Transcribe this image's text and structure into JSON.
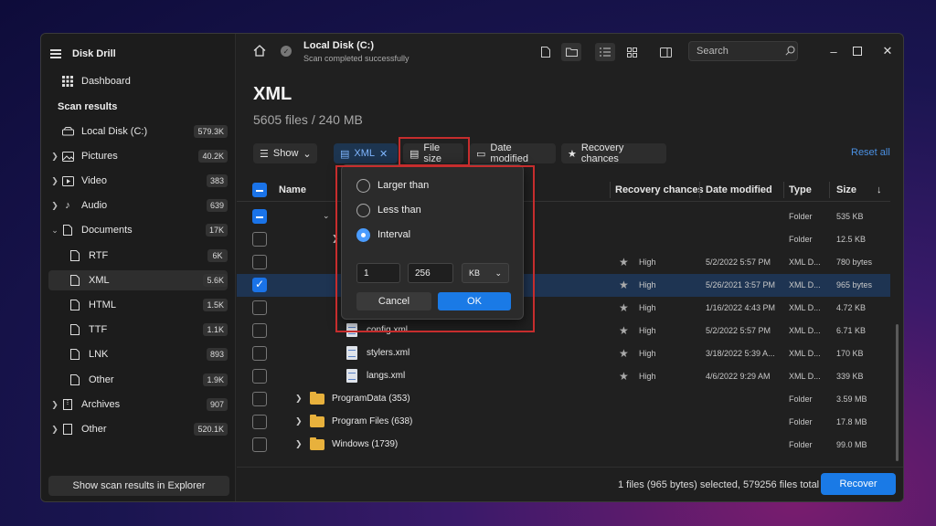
{
  "app": {
    "title": "Disk Drill"
  },
  "sidebar": {
    "dashboard": "Dashboard",
    "section": "Scan results",
    "items": [
      {
        "label": "Local Disk (C:)",
        "count": "579.3K"
      },
      {
        "label": "Pictures",
        "count": "40.2K"
      },
      {
        "label": "Video",
        "count": "383"
      },
      {
        "label": "Audio",
        "count": "639"
      },
      {
        "label": "Documents",
        "count": "17K"
      },
      {
        "label": "RTF",
        "count": "6K"
      },
      {
        "label": "XML",
        "count": "5.6K"
      },
      {
        "label": "HTML",
        "count": "1.5K"
      },
      {
        "label": "TTF",
        "count": "1.1K"
      },
      {
        "label": "LNK",
        "count": "893"
      },
      {
        "label": "Other",
        "count": "1.9K"
      },
      {
        "label": "Archives",
        "count": "907"
      },
      {
        "label": "Other",
        "count": "520.1K"
      }
    ],
    "explorer_button": "Show scan results in Explorer"
  },
  "topbar": {
    "disk_title": "Local Disk (C:)",
    "disk_status": "Scan completed successfully",
    "search_placeholder": "Search"
  },
  "page": {
    "title": "XML",
    "summary": "5605 files / 240 MB"
  },
  "filters": {
    "show": "Show",
    "xml": "XML",
    "file_size": "File size",
    "date_modified": "Date modified",
    "recovery_chances": "Recovery chances",
    "reset": "Reset all"
  },
  "table": {
    "headers": {
      "name": "Name",
      "recovery": "Recovery chances",
      "date": "Date modified",
      "type": "Type",
      "size": "Size"
    },
    "rows": [
      {
        "name": "",
        "recovery": "",
        "date": "",
        "type": "Folder",
        "size": "535 KB"
      },
      {
        "name": "",
        "recovery": "",
        "date": "",
        "type": "Folder",
        "size": "12.5 KB"
      },
      {
        "name": "",
        "recovery": "High",
        "date": "5/2/2022 5:57 PM",
        "type": "XML D...",
        "size": "780 bytes"
      },
      {
        "name": "",
        "recovery": "High",
        "date": "5/26/2021 3:57 PM",
        "type": "XML D...",
        "size": "965 bytes"
      },
      {
        "name": "",
        "recovery": "High",
        "date": "1/16/2022 4:43 PM",
        "type": "XML D...",
        "size": "4.72 KB"
      },
      {
        "name": "config.xml",
        "recovery": "High",
        "date": "5/2/2022 5:57 PM",
        "type": "XML D...",
        "size": "6.71 KB"
      },
      {
        "name": "stylers.xml",
        "recovery": "High",
        "date": "3/18/2022 5:39 A...",
        "type": "XML D...",
        "size": "170 KB"
      },
      {
        "name": "langs.xml",
        "recovery": "High",
        "date": "4/6/2022 9:29 AM",
        "type": "XML D...",
        "size": "339 KB"
      },
      {
        "name": "ProgramData (353)",
        "recovery": "",
        "date": "",
        "type": "Folder",
        "size": "3.59 MB"
      },
      {
        "name": "Program Files (638)",
        "recovery": "",
        "date": "",
        "type": "Folder",
        "size": "17.8 MB"
      },
      {
        "name": "Windows (1739)",
        "recovery": "",
        "date": "",
        "type": "Folder",
        "size": "99.0 MB"
      }
    ]
  },
  "popup": {
    "options": [
      "Larger than",
      "Less than",
      "Interval"
    ],
    "min_value": "1",
    "max_value": "256",
    "unit": "KB",
    "cancel": "Cancel",
    "ok": "OK"
  },
  "footer": {
    "status": "1 files (965 bytes) selected, 579256 files total",
    "recover": "Recover"
  },
  "colors": {
    "accent": "#1a7ae6",
    "highlight": "#c62d2d",
    "folder": "#e8b13c"
  }
}
